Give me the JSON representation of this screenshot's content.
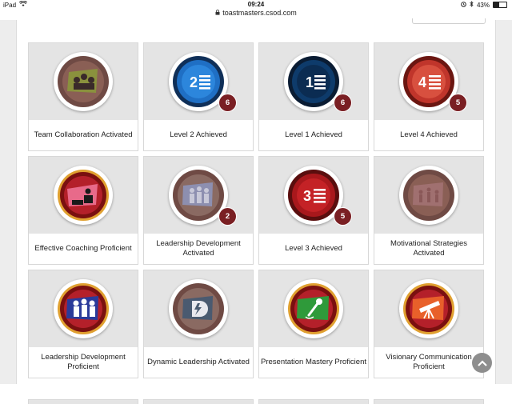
{
  "status_bar": {
    "device": "iPad",
    "time": "09:24",
    "battery": "43%",
    "battery_level": 0.43
  },
  "browser": {
    "url": "toastmasters.csod.com"
  },
  "badges": [
    {
      "label": "Team Collaboration Activated",
      "icon": "team-collaboration-badge-icon",
      "count": ""
    },
    {
      "label": "Level 2 Achieved",
      "icon": "level-2-badge-icon",
      "count": "6"
    },
    {
      "label": "Level 1 Achieved",
      "icon": "level-1-badge-icon",
      "count": "6"
    },
    {
      "label": "Level 4 Achieved",
      "icon": "level-4-badge-icon",
      "count": "5"
    },
    {
      "label": "Effective Coaching Proficient",
      "icon": "effective-coaching-badge-icon",
      "count": ""
    },
    {
      "label": "Leadership Development Activated",
      "icon": "leadership-development-activated-badge-icon",
      "count": "2"
    },
    {
      "label": "Level 3 Achieved",
      "icon": "level-3-badge-icon",
      "count": "5"
    },
    {
      "label": "Motivational Strategies Activated",
      "icon": "motivational-strategies-badge-icon",
      "count": ""
    },
    {
      "label": "Leadership Development Proficient",
      "icon": "leadership-development-proficient-badge-icon",
      "count": ""
    },
    {
      "label": "Dynamic Leadership Activated",
      "icon": "dynamic-leadership-badge-icon",
      "count": ""
    },
    {
      "label": "Presentation Mastery Proficient",
      "icon": "presentation-mastery-badge-icon",
      "count": ""
    },
    {
      "label": "Visionary Communication Proficient",
      "icon": "visionary-communication-badge-icon",
      "count": ""
    }
  ],
  "level_numbers": {
    "level1": "1",
    "level2": "2",
    "level3": "3",
    "level4": "4"
  },
  "colors": {
    "count_badge": "#7a1f23",
    "level_blue": "#1f6fc4",
    "level_navy": "#0e3b6b",
    "level_red": "#c0352b",
    "proficient_gold": "#e0a030",
    "muted_brown": "#7a5a50"
  }
}
